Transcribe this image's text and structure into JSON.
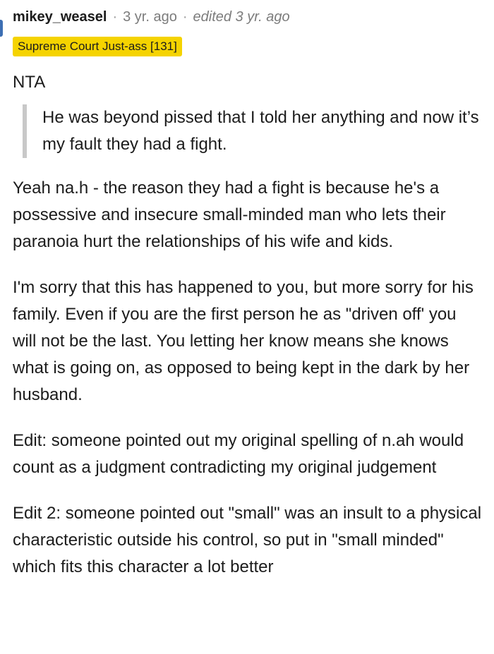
{
  "comment": {
    "author": "mikey_weasel",
    "separator": "·",
    "age": "3 yr. ago",
    "edited": "edited 3 yr. ago",
    "flair": "Supreme Court Just-ass [131]",
    "verdict": "NTA",
    "quote": "He was beyond pissed that I told her anything and now it’s my fault they had a fight.",
    "paragraphs": [
      "Yeah na.h - the reason they had a fight is because he's a possessive and insecure small-minded man who lets their paranoia hurt the relationships of his wife and kids.",
      "I'm sorry that this has happened to you, but more sorry for his family. Even if you are the first person he as \"driven off' you will not be the last. You letting her know means she knows what is going on, as opposed to being kept in the dark by her husband.",
      "Edit: someone pointed out my original spelling of n.ah would count as a judgment contradicting my original judgement",
      "Edit 2: someone pointed out \"small\" was an insult to a physical characteristic outside his control, so put in \"small minded\" which fits this character a lot better"
    ]
  },
  "colors": {
    "flair_bg": "#f5d300",
    "thread_line": "#3d6fb3",
    "quote_border": "#c8c8c8",
    "meta_text": "#7c7c7c"
  }
}
